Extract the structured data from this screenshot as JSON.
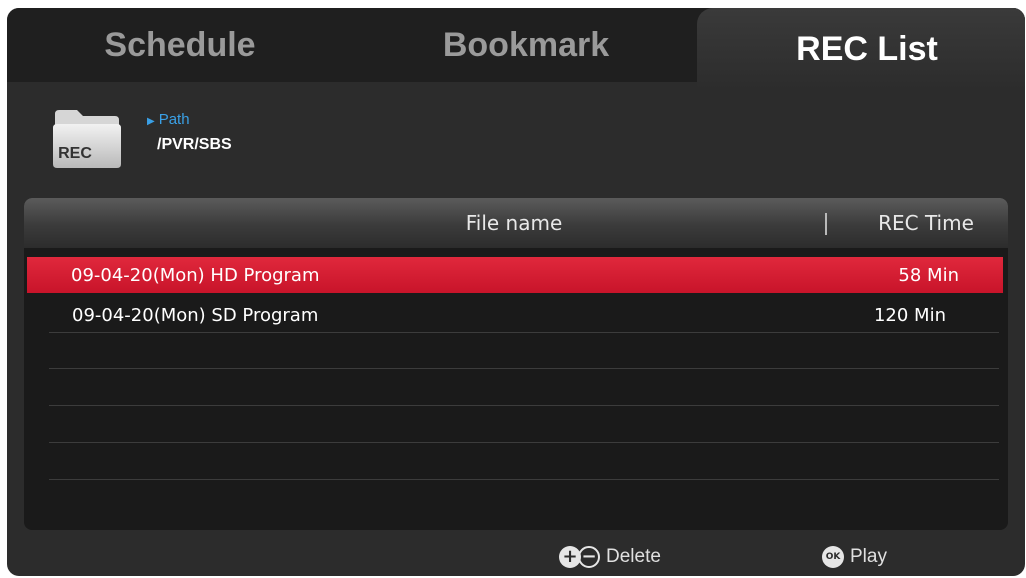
{
  "tabs": [
    {
      "label": "Schedule"
    },
    {
      "label": "Bookmark"
    },
    {
      "label": "REC List",
      "active": true
    }
  ],
  "path": {
    "label": "Path",
    "value": "/PVR/SBS",
    "folder_badge": "REC"
  },
  "list": {
    "columns": {
      "file_name": "File name",
      "rec_time": "REC Time"
    },
    "rows": [
      {
        "name": "09-04-20(Mon) HD Program",
        "time": "58 Min",
        "selected": true
      },
      {
        "name": "09-04-20(Mon) SD Program",
        "time": "120 Min",
        "selected": false
      }
    ]
  },
  "footer": {
    "delete_label": "Delete",
    "play_label": "Play",
    "ok_glyph": "OK",
    "plus_glyph": "+",
    "minus_glyph": "−"
  },
  "colors": {
    "selected_row": "#d21e32",
    "path_label": "#3aa0e6",
    "background": "#2c2c2c"
  }
}
